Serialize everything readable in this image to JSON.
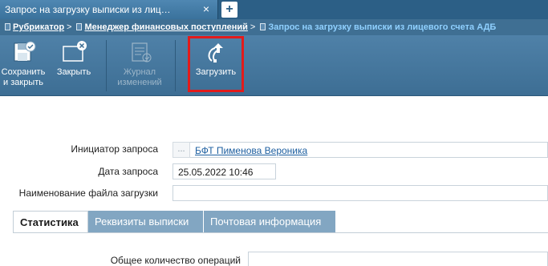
{
  "tab": {
    "title": "Запрос на загрузку выписки из лиц…",
    "close_icon": "×",
    "new_tab_icon": "+"
  },
  "breadcrumb": {
    "items": [
      "Рубрикатор",
      "Менеджер финансовых поступлений"
    ],
    "separator": ">",
    "current": "Запрос на загрузку выписки из лицевого счета АДБ"
  },
  "toolbar": {
    "save_close": "Сохранить\nи закрыть",
    "close": "Закрыть",
    "change_log": "Журнал\nизменений",
    "upload": "Загрузить"
  },
  "form": {
    "initiator_label": "Инициатор запроса",
    "initiator_button": "...",
    "initiator_value": "БФТ Пименова Вероника",
    "date_label": "Дата запроса",
    "date_value": "25.05.2022 10:46",
    "filename_label": "Наименование файла загрузки",
    "filename_value": "",
    "operations_label": "Общее количество операций"
  },
  "inner_tabs": [
    "Статистика",
    "Реквизиты выписки",
    "Почтовая информация"
  ],
  "colors": {
    "tab_bg": "#3a729c",
    "toolbar_bg": "#4f81a8",
    "highlight": "#e21b1b",
    "link": "#1d5fa0",
    "active_crumb": "#8fd0ff"
  }
}
